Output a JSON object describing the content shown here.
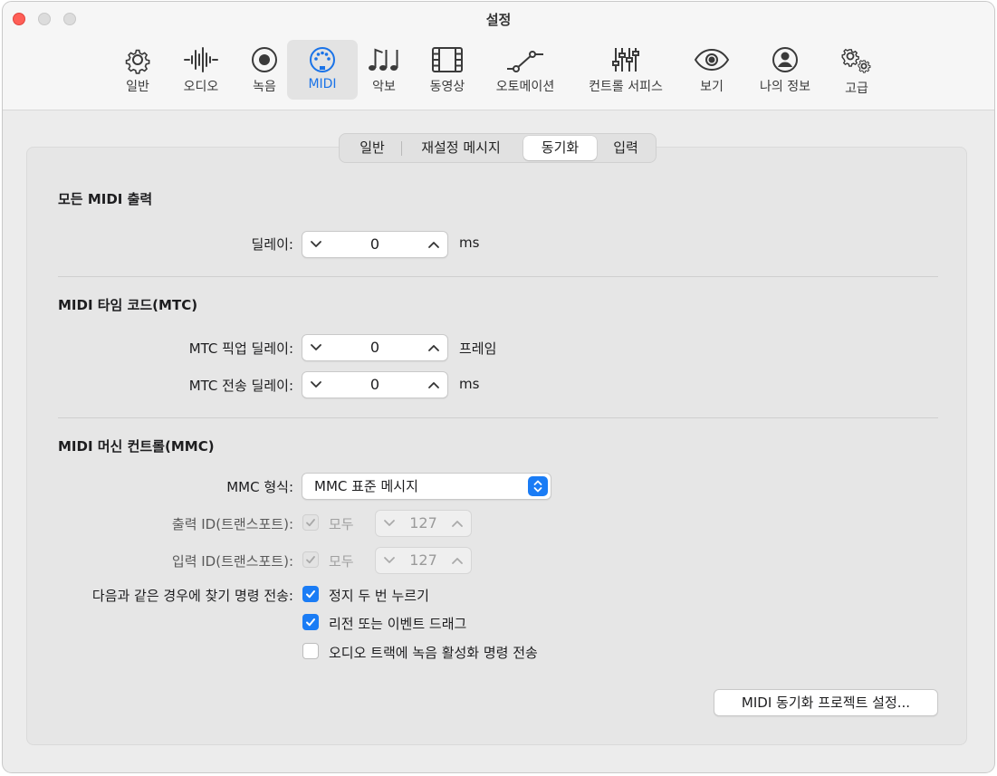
{
  "window": {
    "title": "설정"
  },
  "toolbar": {
    "accent_color": "#1a73e8",
    "items": [
      {
        "label": "일반",
        "icon": "gear-icon"
      },
      {
        "label": "오디오",
        "icon": "waveform-icon"
      },
      {
        "label": "녹음",
        "icon": "record-icon"
      },
      {
        "label": "MIDI",
        "icon": "midi-connector-icon",
        "active": true
      },
      {
        "label": "악보",
        "icon": "music-notes-icon"
      },
      {
        "label": "동영상",
        "icon": "film-icon"
      },
      {
        "label": "오토메이션",
        "icon": "automation-curve-icon"
      },
      {
        "label": "컨트롤 서피스",
        "icon": "sliders-icon"
      },
      {
        "label": "보기",
        "icon": "eye-icon"
      },
      {
        "label": "나의 정보",
        "icon": "person-icon"
      },
      {
        "label": "고급",
        "icon": "gears-icon"
      }
    ]
  },
  "tabs": {
    "items": [
      "일반",
      "재설정 메시지",
      "동기화",
      "입력"
    ],
    "selected": "동기화"
  },
  "midi_output": {
    "title": "모든 MIDI 출력",
    "delay_label": "딜레이:",
    "delay_value": "0",
    "delay_unit": "ms"
  },
  "mtc": {
    "title": "MIDI 타임 코드(MTC)",
    "pickup_label": "MTC 픽업 딜레이:",
    "pickup_value": "0",
    "pickup_unit": "프레임",
    "send_label": "MTC 전송 딜레이:",
    "send_value": "0",
    "send_unit": "ms"
  },
  "mmc": {
    "title": "MIDI 머신 컨트롤(MMC)",
    "format_label": "MMC 형식:",
    "format_value": "MMC 표준 메시지",
    "out_id_label": "출력 ID(트랜스포트):",
    "out_all_label": "모두",
    "out_all_checked": true,
    "out_id_value": "127",
    "in_id_label": "입력 ID(트랜스포트):",
    "in_all_label": "모두",
    "in_all_checked": true,
    "in_id_value": "127",
    "locate_label": "다음과 같은 경우에 찾기 명령 전송:",
    "locate_options": [
      {
        "label": "정지 두 번 누르기",
        "checked": true
      },
      {
        "label": "리전 또는 이벤트 드래그",
        "checked": true
      },
      {
        "label": "오디오 트랙에 녹음 활성화 명령 전송",
        "checked": false
      }
    ]
  },
  "footer": {
    "project_button_label": "MIDI 동기화 프로젝트 설정..."
  }
}
